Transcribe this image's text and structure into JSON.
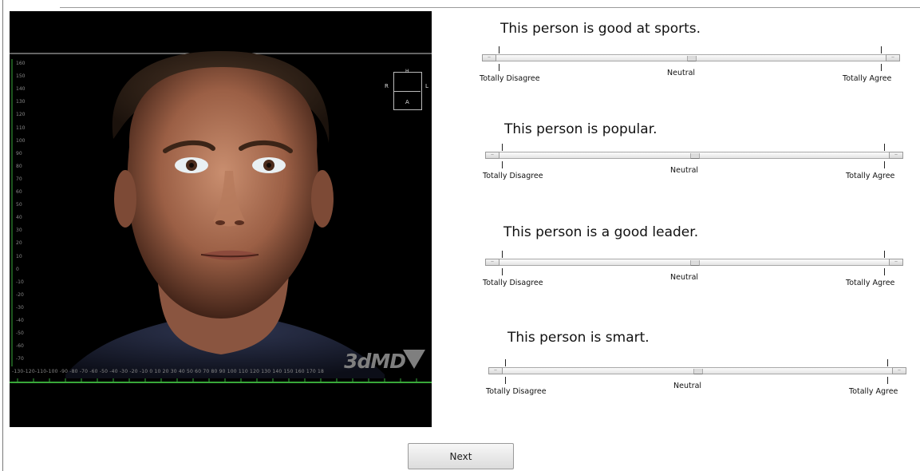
{
  "scan": {
    "brand": "3dMD",
    "orientation": {
      "right": "R",
      "left": "L",
      "anterior": "A",
      "head": "H"
    },
    "ruler_labels": [
      "160",
      "150",
      "140",
      "130",
      "120",
      "110",
      "100",
      "90",
      "80",
      "70",
      "60",
      "50",
      "40",
      "30",
      "20",
      "10",
      "0",
      "-10",
      "-20",
      "-30",
      "-40",
      "-50",
      "-60",
      "-70"
    ],
    "x_axis_labels": "-130-120-110-100 -90 -80 -70 -60 -50 -40 -30 -20 -10  0  10  20  30  40  50  60  70  80  90  100 110 120 130 140 150 160 170 18"
  },
  "questions": [
    {
      "text": "This person is good at sports.",
      "left_label": "Totally Disagree",
      "mid_label": "Neutral",
      "right_label": "Totally Agree"
    },
    {
      "text": "This person is popular.",
      "left_label": "Totally Disagree",
      "mid_label": "Neutral",
      "right_label": "Totally Agree"
    },
    {
      "text": "This person is a good leader.",
      "left_label": "Totally Disagree",
      "mid_label": "Neutral",
      "right_label": "Totally Agree"
    },
    {
      "text": "This person is smart.",
      "left_label": "Totally Disagree",
      "mid_label": "Neutral",
      "right_label": "Totally Agree"
    }
  ],
  "next_button": "Next",
  "colors": {
    "ruler_green": "#39a83a",
    "scan_bg": "#000000"
  }
}
